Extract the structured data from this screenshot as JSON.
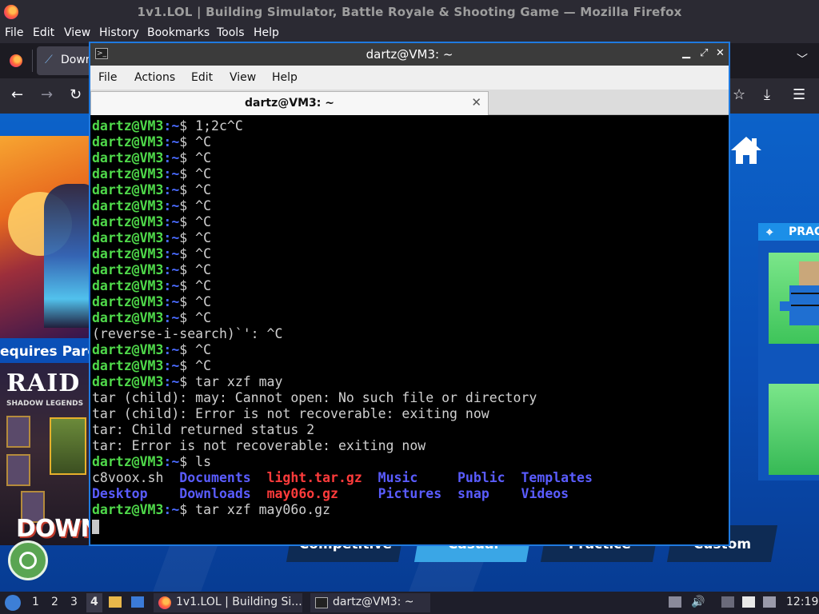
{
  "firefox": {
    "title": "1v1.LOL | Building Simulator, Battle Royale & Shooting Game — Mozilla Firefox",
    "menu": [
      "File",
      "Edit",
      "View",
      "History",
      "Bookmarks",
      "Tools",
      "Help"
    ],
    "tab_label": "Down",
    "toolbar_icons": [
      "back-icon",
      "forward-icon",
      "reload-icon",
      "bookmark-star-icon",
      "downloads-icon",
      "menu-icon"
    ]
  },
  "game_page": {
    "requires_parent_label": "equires Paren",
    "ad_title": "RAID",
    "ad_subtitle": "SHADOW LEGENDS",
    "ad_download": "DOWNL",
    "practice_label": "PRAC",
    "modes": [
      "Competitive",
      "Casual",
      "Practice",
      "Custom"
    ],
    "icons": [
      "home-icon",
      "crosshair-icon",
      "cookie-icon"
    ]
  },
  "terminal": {
    "title": "dartz@VM3: ~",
    "menu": [
      "File",
      "Actions",
      "Edit",
      "View",
      "Help"
    ],
    "tab_label": "dartz@VM3: ~",
    "user": "dartz@VM3",
    "path": ":~",
    "dollar": "$ ",
    "lines": [
      {
        "kind": "prompt",
        "cmd": "1;2c^C"
      },
      {
        "kind": "prompt",
        "cmd": "^C"
      },
      {
        "kind": "prompt",
        "cmd": "^C"
      },
      {
        "kind": "prompt",
        "cmd": "^C"
      },
      {
        "kind": "prompt",
        "cmd": "^C"
      },
      {
        "kind": "prompt",
        "cmd": "^C"
      },
      {
        "kind": "prompt",
        "cmd": "^C"
      },
      {
        "kind": "prompt",
        "cmd": "^C"
      },
      {
        "kind": "prompt",
        "cmd": "^C"
      },
      {
        "kind": "prompt",
        "cmd": "^C"
      },
      {
        "kind": "prompt",
        "cmd": "^C"
      },
      {
        "kind": "prompt",
        "cmd": "^C"
      },
      {
        "kind": "prompt",
        "cmd": "^C"
      },
      {
        "kind": "output",
        "text": "(reverse-i-search)`': ^C"
      },
      {
        "kind": "prompt",
        "cmd": "^C"
      },
      {
        "kind": "prompt",
        "cmd": "^C"
      },
      {
        "kind": "prompt",
        "cmd": "tar xzf may"
      },
      {
        "kind": "output",
        "text": "tar (child): may: Cannot open: No such file or directory"
      },
      {
        "kind": "output",
        "text": "tar (child): Error is not recoverable: exiting now"
      },
      {
        "kind": "output",
        "text": "tar: Child returned status 2"
      },
      {
        "kind": "output",
        "text": "tar: Error is not recoverable: exiting now"
      },
      {
        "kind": "prompt",
        "cmd": "ls"
      },
      {
        "kind": "ls",
        "items": [
          {
            "text": "c8voox.sh",
            "type": "file"
          },
          {
            "text": "Documents",
            "type": "dir"
          },
          {
            "text": "light.tar.gz",
            "type": "archive"
          },
          {
            "text": "Music",
            "type": "dir"
          },
          {
            "text": "Public",
            "type": "dir"
          },
          {
            "text": "Templates",
            "type": "dir"
          }
        ]
      },
      {
        "kind": "ls",
        "items": [
          {
            "text": "Desktop",
            "type": "dir"
          },
          {
            "text": "Downloads",
            "type": "dir"
          },
          {
            "text": "may06o.gz",
            "type": "archive"
          },
          {
            "text": "Pictures",
            "type": "dir"
          },
          {
            "text": "snap",
            "type": "dir"
          },
          {
            "text": "Videos",
            "type": "dir"
          }
        ]
      },
      {
        "kind": "prompt",
        "cmd": "tar xzf may06o.gz"
      },
      {
        "kind": "cursor"
      }
    ],
    "colors": {
      "user": "#4fd94a",
      "path": "#4a6bff",
      "dir": "#5a5cff",
      "archive": "#ff3b3b",
      "text": "#d0d0d0"
    }
  },
  "taskbar": {
    "workspaces": [
      "1",
      "2",
      "3",
      "4"
    ],
    "active_workspace": "4",
    "tasks": [
      "1v1.LOL | Building Si...",
      "dartz@VM3: ~"
    ],
    "clock": "12:19"
  }
}
